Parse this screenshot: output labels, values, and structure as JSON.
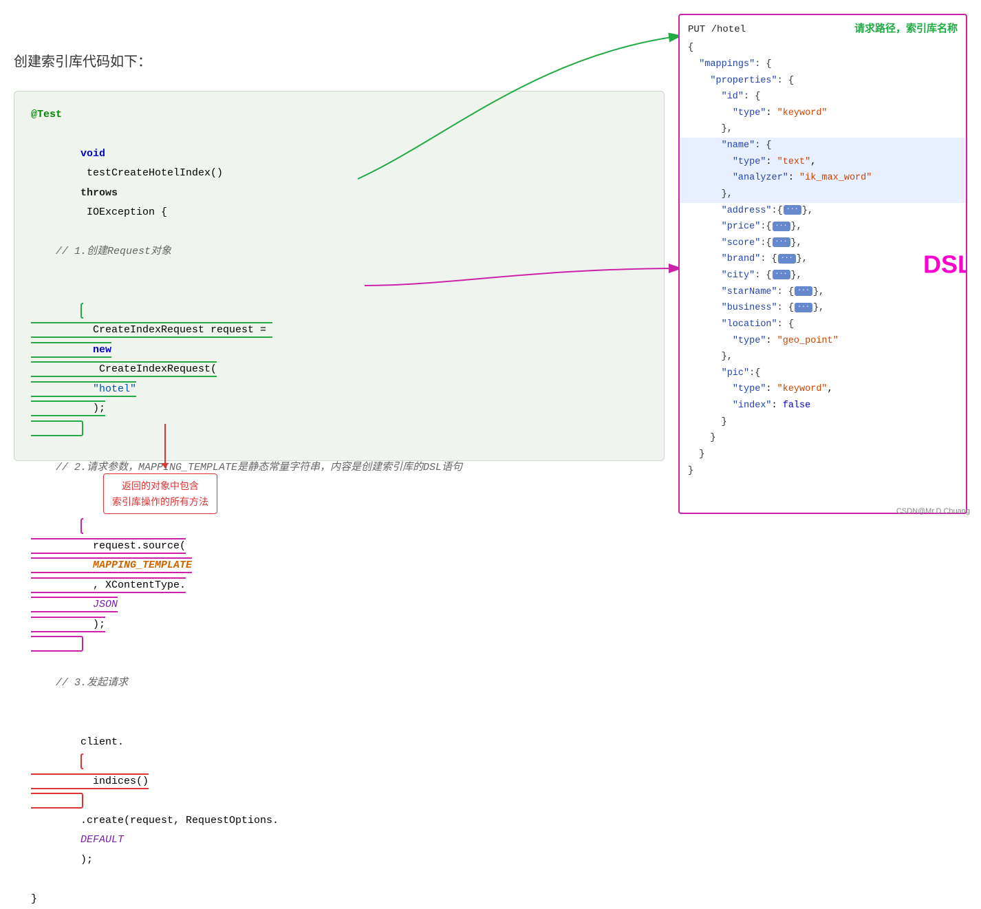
{
  "page": {
    "title": "创建索引库代码如下：",
    "watermark": "CSDN@Mr.D.Chuang"
  },
  "left": {
    "title": "创建索引库代码如下：",
    "code": {
      "annotation1": "@Test",
      "line1": "void testCreateHotelIndex() throws IOException {",
      "comment1": "    // 1.创建Request对象",
      "line2_pre": "    CreateIndexRequest request = ",
      "line2_new": "new",
      "line2_post": " CreateIndexRequest(",
      "line2_str": "\"hotel\"",
      "line2_end": ");",
      "comment2": "    // 2.请求参数，MAPPING_TEMPLATE是静态常量字符串，内容是创建索引库的DSL语句",
      "line3_pre": "    request.source(",
      "line3_template": "MAPPING_TEMPLATE",
      "line3_mid": ", XContentType.",
      "line3_json": "JSON",
      "line3_end": ");",
      "comment3": "    // 3.发起请求",
      "line4_pre": "    client.",
      "line4_indices": "indices()",
      "line4_post": ".create(request, RequestOptions.",
      "line4_default": "DEFAULT",
      "line4_end": ");",
      "close": "}"
    },
    "annotation_box": {
      "line1": "返回的对象中包含",
      "line2": "索引库操作的所有方法"
    }
  },
  "right": {
    "put_label": "PUT /hotel",
    "path_label": "请求路径，索引库名称",
    "dsl_label": "DSL",
    "json_content": [
      "{",
      "  \"mappings\": {",
      "    \"properties\": {",
      "      \"id\": {",
      "        \"type\": \"keyword\"",
      "      },",
      "      \"name\": {",
      "        \"type\": \"text\",",
      "        \"analyzer\": \"ik_max_word\"",
      "      },",
      "      \"address\":{...},",
      "      \"price\":{...},",
      "      \"score\":{...},",
      "      \"brand\": {...},",
      "      \"city\": {...},",
      "      \"starName\": {...},",
      "      \"business\": {...},",
      "      \"location\": {",
      "        \"type\": \"geo_point\"",
      "      },",
      "      \"pic\":{",
      "        \"type\": \"keyword\",",
      "        \"index\": false",
      "      }",
      "    }",
      "  }",
      "}"
    ]
  }
}
